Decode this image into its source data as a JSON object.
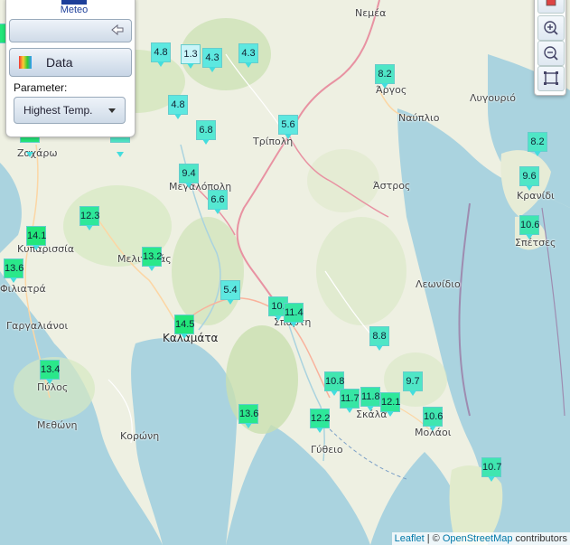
{
  "logo": {
    "text": "Meteo"
  },
  "panel": {
    "data_button_label": "Data",
    "parameter_label": "Parameter:",
    "parameter_value": "Highest Temp."
  },
  "attribution": {
    "leaflet": "Leaflet",
    "sep": " | © ",
    "osm": "OpenStreetMap",
    "contrib": " contributors"
  },
  "places": [
    {
      "name": "Νεμέα"
    },
    {
      "name": "Άργος"
    },
    {
      "name": "Ναύπλιο"
    },
    {
      "name": "Λυγουριό"
    },
    {
      "name": "Τρίπολη"
    },
    {
      "name": "Ζαχάρω"
    },
    {
      "name": "Μεγαλόπολη"
    },
    {
      "name": "Άστρος"
    },
    {
      "name": "Κρανίδι"
    },
    {
      "name": "Σπέτσες"
    },
    {
      "name": "Κυπαρισσία"
    },
    {
      "name": "Μελιγαλάς"
    },
    {
      "name": "Φιλιατρά"
    },
    {
      "name": "Λεωνίδιο"
    },
    {
      "name": "Γαργαλιάνοι"
    },
    {
      "name": "Σπάρτη"
    },
    {
      "name": "Καλαμάτα"
    },
    {
      "name": "Πύλος"
    },
    {
      "name": "Μεθώνη"
    },
    {
      "name": "Κορώνη"
    },
    {
      "name": "Σκάλα"
    },
    {
      "name": "Μολάοι"
    },
    {
      "name": "Γύθειο"
    }
  ],
  "stations": [
    {
      "value": "4.8",
      "color": "#5de8e0"
    },
    {
      "value": "1.3",
      "color": "#c9f4f8"
    },
    {
      "value": "4.3",
      "color": "#5de8e0"
    },
    {
      "value": "4.3",
      "color": "#5de8e0"
    },
    {
      "value": "8.2",
      "color": "#4fe6c6"
    },
    {
      "value": "4.8",
      "color": "#5de8e0"
    },
    {
      "value": "6.8",
      "color": "#55e8d2"
    },
    {
      "value": "5.6",
      "color": "#5de8e0"
    },
    {
      "value": "8.2",
      "color": "#4fe6c6"
    },
    {
      "value": "9.4",
      "color": "#4fe6c6"
    },
    {
      "value": "9.6",
      "color": "#4fe6c6"
    },
    {
      "value": "6.6",
      "color": "#55e8d2"
    },
    {
      "value": "12.3",
      "color": "#2ee89a"
    },
    {
      "value": "10.6",
      "color": "#40e6b0"
    },
    {
      "value": "14.1",
      "color": "#22e67a"
    },
    {
      "value": "13.2",
      "color": "#2ae88a"
    },
    {
      "value": "13.6",
      "color": "#2ae88a"
    },
    {
      "value": "5.4",
      "color": "#5de8e0"
    },
    {
      "value": "10.",
      "color": "#40e6b0"
    },
    {
      "value": "11.4",
      "color": "#36e6a4"
    },
    {
      "value": "14.5",
      "color": "#22e67a"
    },
    {
      "value": "8.8",
      "color": "#4fe6c6"
    },
    {
      "value": "13.4",
      "color": "#2ae88a"
    },
    {
      "value": "10.8",
      "color": "#40e6b0"
    },
    {
      "value": "9.7",
      "color": "#4fe6c6"
    },
    {
      "value": "11.7",
      "color": "#36e6a4"
    },
    {
      "value": "11.8",
      "color": "#36e6a4"
    },
    {
      "value": "12.1",
      "color": "#2ee89a"
    },
    {
      "value": "13.6",
      "color": "#2ae88a"
    },
    {
      "value": "12.2",
      "color": "#2ee89a"
    },
    {
      "value": "10.6",
      "color": "#40e6b0"
    },
    {
      "value": "10.7",
      "color": "#40e6b0"
    }
  ]
}
